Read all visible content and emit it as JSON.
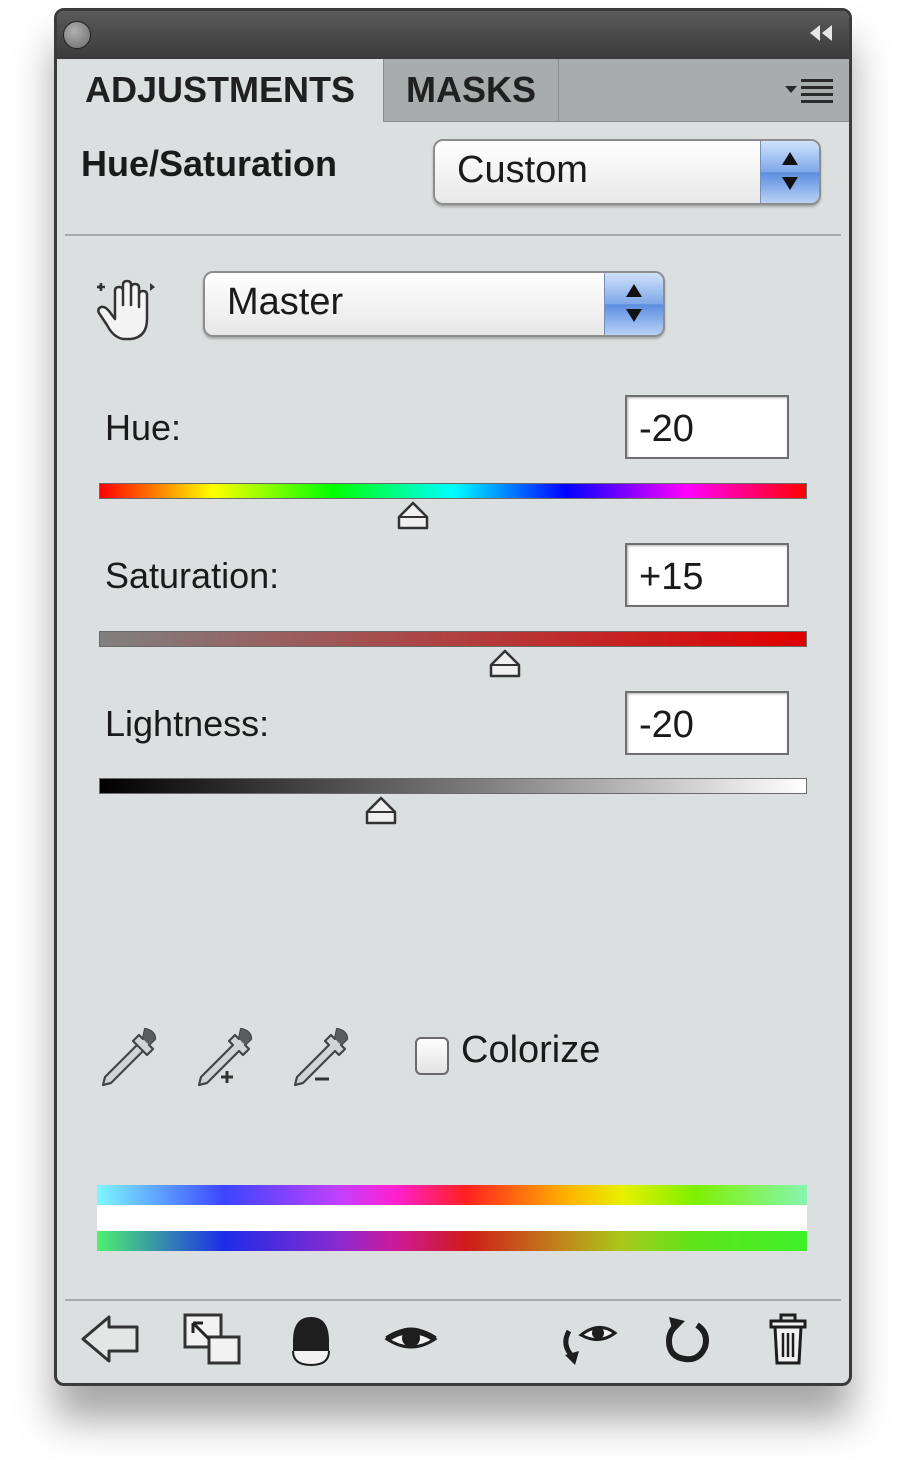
{
  "tabs": [
    {
      "label": "ADJUSTMENTS",
      "active": true
    },
    {
      "label": "MASKS",
      "active": false
    }
  ],
  "panel": {
    "title": "Hue/Saturation",
    "preset": {
      "selected": "Custom"
    }
  },
  "channel": {
    "selected": "Master"
  },
  "sliders": {
    "hue": {
      "label": "Hue:",
      "value": "-20",
      "min": -180,
      "max": 180,
      "position": -20
    },
    "saturation": {
      "label": "Saturation:",
      "value": "+15",
      "min": -100,
      "max": 100,
      "position": 15
    },
    "lightness": {
      "label": "Lightness:",
      "value": "-20",
      "min": -100,
      "max": 100,
      "position": -20
    }
  },
  "colorize": {
    "label": "Colorize",
    "checked": false
  },
  "icons": {
    "titlebar": [
      "close-icon",
      "collapse-icon"
    ],
    "tools": [
      "targeted-adjustment-hand-icon",
      "eyedropper-icon",
      "eyedropper-add-icon",
      "eyedropper-subtract-icon"
    ],
    "footer": [
      "back-arrow-icon",
      "clip-to-layer-icon",
      "layer-mask-icon",
      "visibility-eye-icon",
      "view-previous-icon",
      "reset-icon",
      "trash-icon"
    ],
    "panel_menu": "panel-menu-icon"
  },
  "colors": {
    "panel_bg": "#dcdfdf",
    "tabbar_bg": "#a9acac",
    "titlebar_bg": "#3a3a3a",
    "select_arrow_blue": "#5b8ee0"
  }
}
